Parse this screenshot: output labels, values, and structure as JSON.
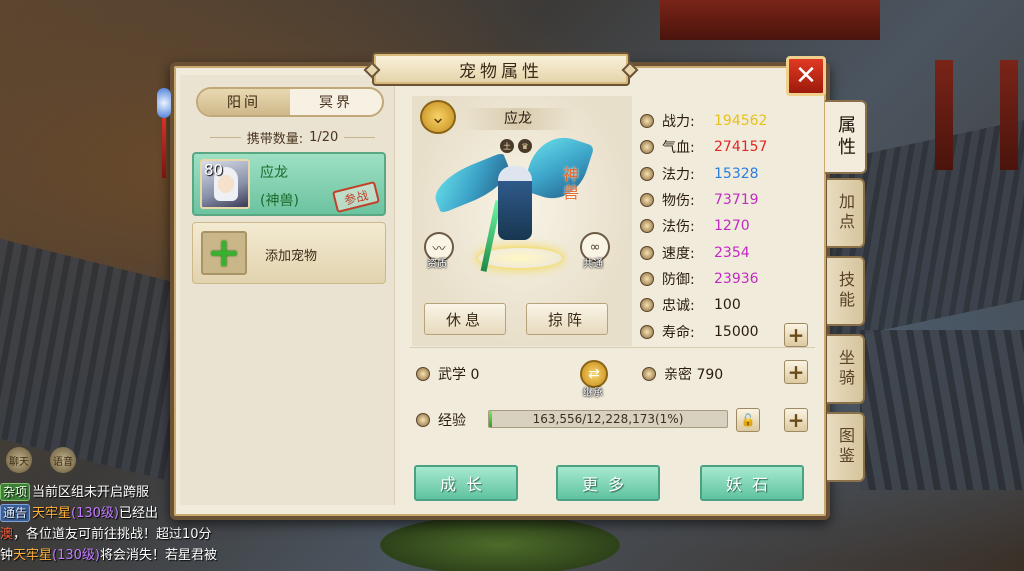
{
  "panel": {
    "title": "宠物属性",
    "close_label": "✕"
  },
  "realm_tabs": [
    {
      "label": "阳间",
      "active": true
    },
    {
      "label": "冥界",
      "active": false
    }
  ],
  "carry": {
    "label": "携带数量:",
    "value": "1/20"
  },
  "pet_list": [
    {
      "level": "80",
      "name": "应龙",
      "type": "(神兽)",
      "stamp": "参战"
    }
  ],
  "add_pet_label": "添加宠物",
  "portrait": {
    "name": "应龙",
    "beast_label": "神兽",
    "left_badge_caption": "资质",
    "right_badge_caption": "共通"
  },
  "actions": {
    "rest": "休息",
    "formation": "掠阵"
  },
  "stats": [
    {
      "label": "战力:",
      "value": "194562",
      "color": "#e6c21a"
    },
    {
      "label": "气血:",
      "value": "274157",
      "color": "#e02626"
    },
    {
      "label": "法力:",
      "value": "15328",
      "color": "#2a7ee0"
    },
    {
      "label": "物伤:",
      "value": "73719",
      "color": "#c22ac2"
    },
    {
      "label": "法伤:",
      "value": "1270",
      "color": "#c22ac2"
    },
    {
      "label": "速度:",
      "value": "2354",
      "color": "#c22ac2"
    },
    {
      "label": "防御:",
      "value": "23936",
      "color": "#c22ac2"
    },
    {
      "label": "忠诚:",
      "value": "100",
      "color": "#2a1c10"
    },
    {
      "label": "寿命:",
      "value": "15000",
      "color": "#2a1c10"
    }
  ],
  "martial": {
    "label": "武学",
    "value": "0"
  },
  "inherit_caption": "继承",
  "intimacy": {
    "label": "亲密",
    "value": "790"
  },
  "exp": {
    "label": "经验",
    "text": "163,556/12,228,173(1%)",
    "fraction": 0.013
  },
  "bottom_buttons": {
    "grow": "成长",
    "more": "更多",
    "stone": "妖石"
  },
  "side_tabs": [
    {
      "label": "属性",
      "active": true
    },
    {
      "label": "加点",
      "active": false
    },
    {
      "label": "技能",
      "active": false
    },
    {
      "label": "坐骑",
      "active": false
    },
    {
      "label": "图鉴",
      "active": false
    }
  ],
  "chat": {
    "icons": [
      "聊天",
      "语音"
    ],
    "lines": [
      {
        "tag": "杂项",
        "tag_type": "green",
        "parts": [
          {
            "text": "当前区组未开启跨服",
            "cls": ""
          }
        ]
      },
      {
        "tag": "通告",
        "tag_type": "blue",
        "parts": [
          {
            "text": "天牢星",
            "cls": "c-orange"
          },
          {
            "text": "(130级)",
            "cls": "c-purple"
          },
          {
            "text": "已经出",
            "cls": ""
          }
        ]
      },
      {
        "tag": "",
        "tag_type": "",
        "parts": [
          {
            "text": "澳",
            "cls": "c-red"
          },
          {
            "text": "，各位道友可前往挑战！超过10分",
            "cls": ""
          }
        ]
      },
      {
        "tag": "",
        "tag_type": "",
        "parts": [
          {
            "text": "钟",
            "cls": ""
          },
          {
            "text": "天牢星",
            "cls": "c-orange"
          },
          {
            "text": "(130级)",
            "cls": "c-purple"
          },
          {
            "text": "将会消失！若星君被",
            "cls": ""
          }
        ]
      }
    ]
  }
}
